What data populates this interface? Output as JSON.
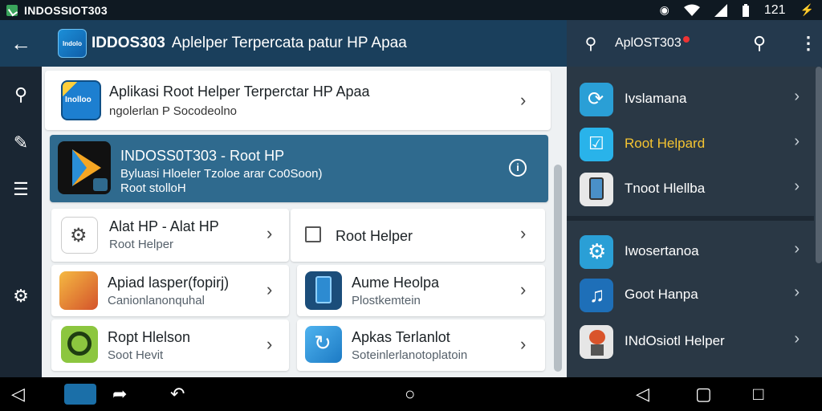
{
  "status_bar": {
    "app_title": "INDOSSIOT303",
    "time": "121",
    "icons": [
      "notification-icon",
      "wifi-icon",
      "signal-icon",
      "battery-icon",
      "bolt-icon"
    ]
  },
  "app_bar": {
    "logo_text": "Indolo",
    "title": "IDDOS303",
    "subtitle": "Aplelper Terpercata patur HP Apaa"
  },
  "side_app_bar": {
    "title": "AplOST303"
  },
  "rail": {
    "icons": [
      "key-icon",
      "brush-icon",
      "list-icon",
      "settings-icon"
    ]
  },
  "cards": {
    "featured": {
      "title": "Aplikasi Root Helper Terperctar HP Apaa",
      "subtitle": "ngolerlan P Socodeolno",
      "icon_text": "Inolloo"
    },
    "highlight": {
      "title": "INDOSS0T303 - Root HP",
      "line1": "Byluasi Hloeler Tzoloe arar Co0Soon)",
      "line2": "Root stolloH"
    },
    "grid": [
      {
        "title": "Alat HP - Alat HP",
        "subtitle": "Root Helper"
      },
      {
        "title": "Root Helper",
        "subtitle": ""
      },
      {
        "title": "Apiad lasper(fopirj)",
        "subtitle": "Canionlanonquhal"
      },
      {
        "title": "Aume Heolpa",
        "subtitle": "Plostkemtein"
      },
      {
        "title": "Ropt Hlelson",
        "subtitle": "Soot Hevit"
      },
      {
        "title": "Apkas Terlanlot",
        "subtitle": "Soteinlerlanotoplatoin"
      }
    ]
  },
  "panel": {
    "items": [
      {
        "label": "Ivslamana",
        "color": "#ffffff"
      },
      {
        "label": "Root Helpard",
        "color": "#f5c431"
      },
      {
        "label": "Tnoot Hlellba",
        "color": "#ffffff"
      },
      {
        "label": "Iwosertanoa",
        "color": "#ffffff"
      },
      {
        "label": "Goot Hanpa",
        "color": "#ffffff"
      },
      {
        "label": "INdOsiotl Helper",
        "color": "#ffffff"
      }
    ]
  },
  "colors": {
    "app_bar": "#1a3f5c",
    "highlight_card": "#2f6a8e",
    "panel_bg": "#2a3845",
    "accent_yellow": "#f5c431"
  }
}
